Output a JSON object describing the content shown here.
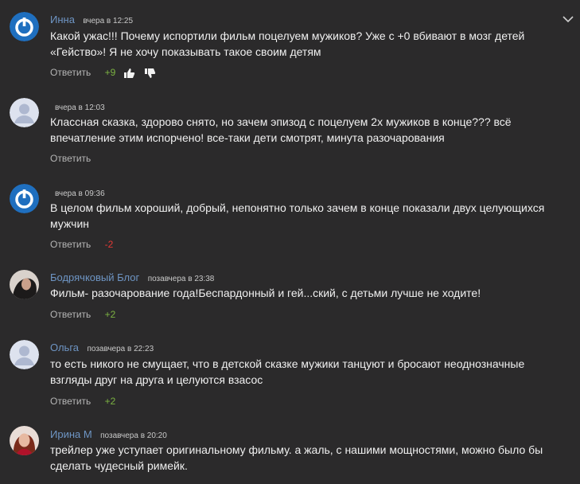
{
  "comments": [
    {
      "author": "Инна",
      "time": "вчера в 12:25",
      "text": "Какой ужас!!! Почему испортили фильм поцелуем мужиков? Уже с +0 вбивают в мозг детей «Гейство»! Я не хочу показывать такое своим детям",
      "reply_label": "Ответить",
      "score": "+9",
      "avatar": "blue-logo-icon"
    },
    {
      "author": "",
      "time": "вчера в 12:03",
      "text": "Классная сказка, здорово снято, но зачем эпизод с поцелуем 2х мужиков в конце??? всё впечатление этим испорчено! все-таки дети смотрят, минута разочарования",
      "reply_label": "Ответить",
      "score": "",
      "avatar": "default-user-icon"
    },
    {
      "author": "",
      "time": "вчера в 09:36",
      "text": "В целом фильм хороший, добрый, непонятно только зачем в конце показали двух целующихся мужчин",
      "reply_label": "Ответить",
      "score": "-2",
      "avatar": "blue-logo-icon"
    },
    {
      "author": "Бодрячковый Блог",
      "time": "позавчера в 23:38",
      "text": "Фильм- разочарование года!Беспардонный и гей...ский, с детьми лучше не ходите!",
      "reply_label": "Ответить",
      "score": "+2",
      "avatar": "photo-avatar"
    },
    {
      "author": "Ольга",
      "time": "позавчера в 22:23",
      "text": "то есть никого не смущает, что в детской сказке мужики танцуют и бросают неоднозначные взгляды друг на друга и целуются взасос",
      "reply_label": "Ответить",
      "score": "+2",
      "avatar": "default-user-icon"
    },
    {
      "author": "Ирина М",
      "time": "позавчера в 20:20",
      "text": "трейлер уже уступает оригинальному фильму. а жаль, с нашими мощностями, можно было бы сделать чудесный римейк.",
      "reply_label": "",
      "score": "",
      "avatar": "photo-avatar"
    }
  ],
  "colors": {
    "background": "#2b2a2b",
    "author": "#6e95c4",
    "positive": "#7cb342",
    "negative": "#e53935"
  }
}
